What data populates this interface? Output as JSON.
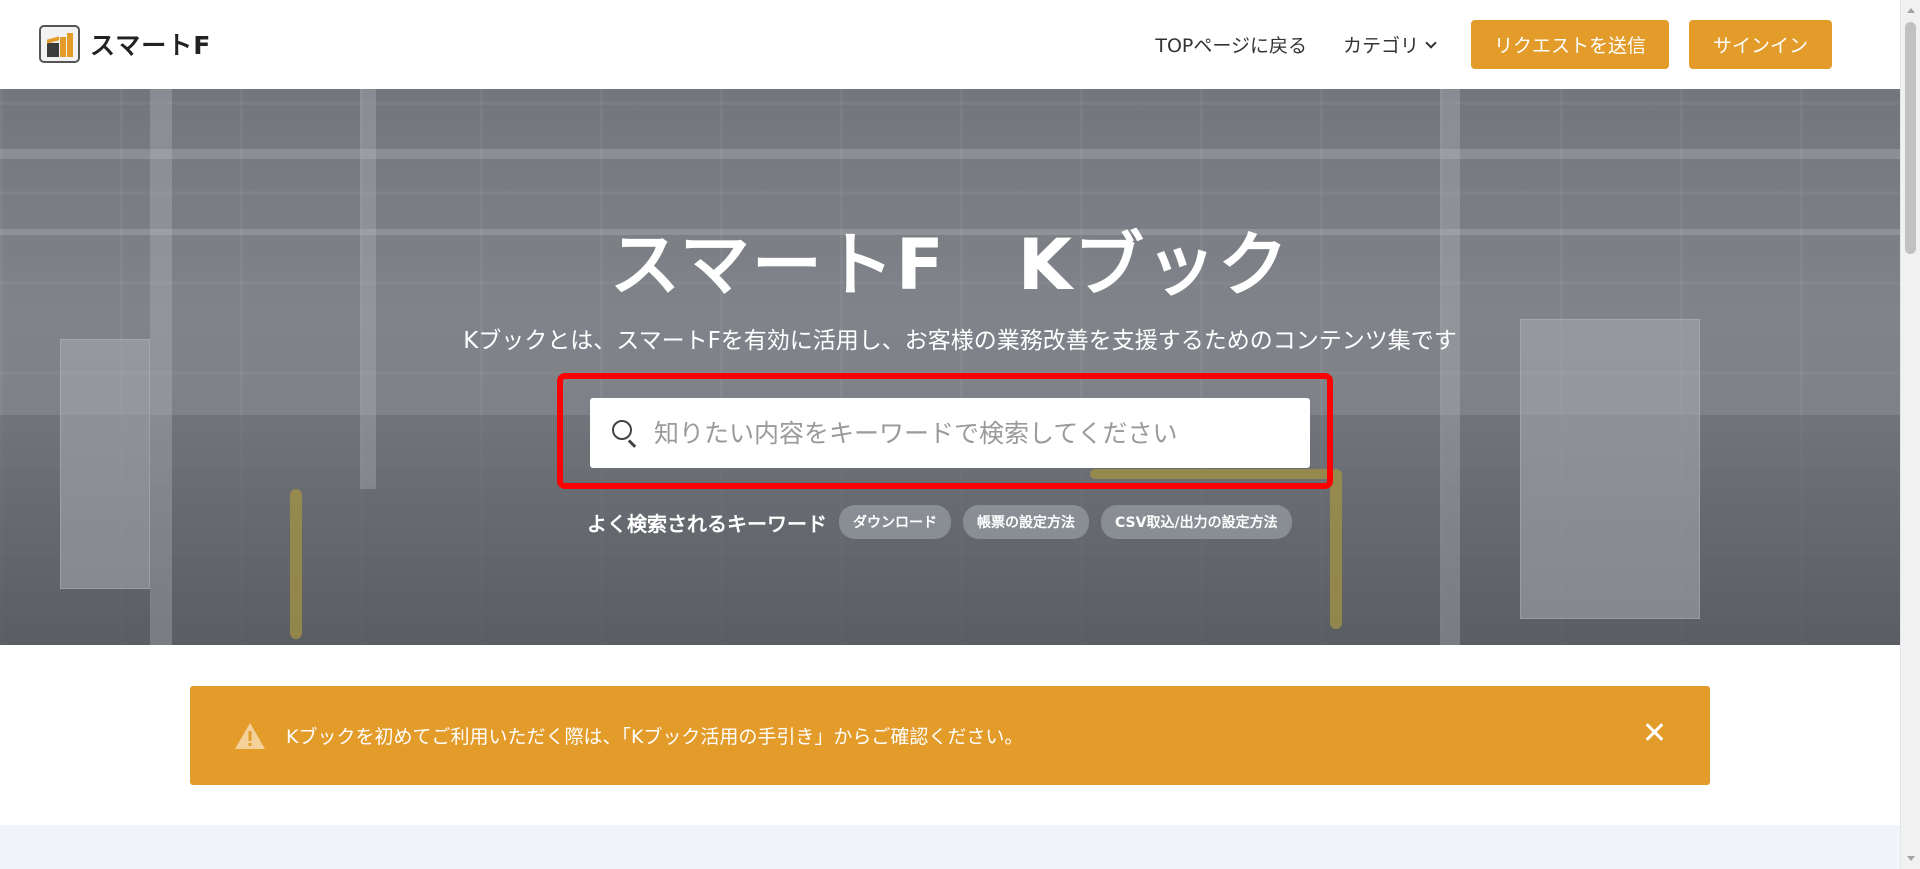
{
  "header": {
    "logo_text": "スマートF",
    "nav": {
      "back_to_top": "TOPページに戻る",
      "category": "カテゴリ"
    },
    "request_button": "リクエストを送信",
    "signin_button": "サインイン"
  },
  "hero": {
    "title": "スマートF　Kブック",
    "subtitle": "Kブックとは、スマートFを有効に活用し、お客様の業務改善を支援するためのコンテンツ集です",
    "search": {
      "placeholder": "知りたい内容をキーワードで検索してください",
      "value": ""
    },
    "keywords": {
      "label": "よく検索されるキーワード",
      "items": [
        "ダウンロード",
        "帳票の設定方法",
        "CSV取込/出力の設定方法"
      ]
    }
  },
  "notice": {
    "text": "Kブックを初めてご利用いただく際は、「Kブック活用の手引き」からご確認ください。"
  },
  "colors": {
    "accent": "#e39b2a",
    "highlight": "#ff0000",
    "bottom_band": "#f1f4f8"
  },
  "icons": [
    "logo-icon",
    "chevron-down-icon",
    "search-icon",
    "warning-icon",
    "close-icon"
  ]
}
